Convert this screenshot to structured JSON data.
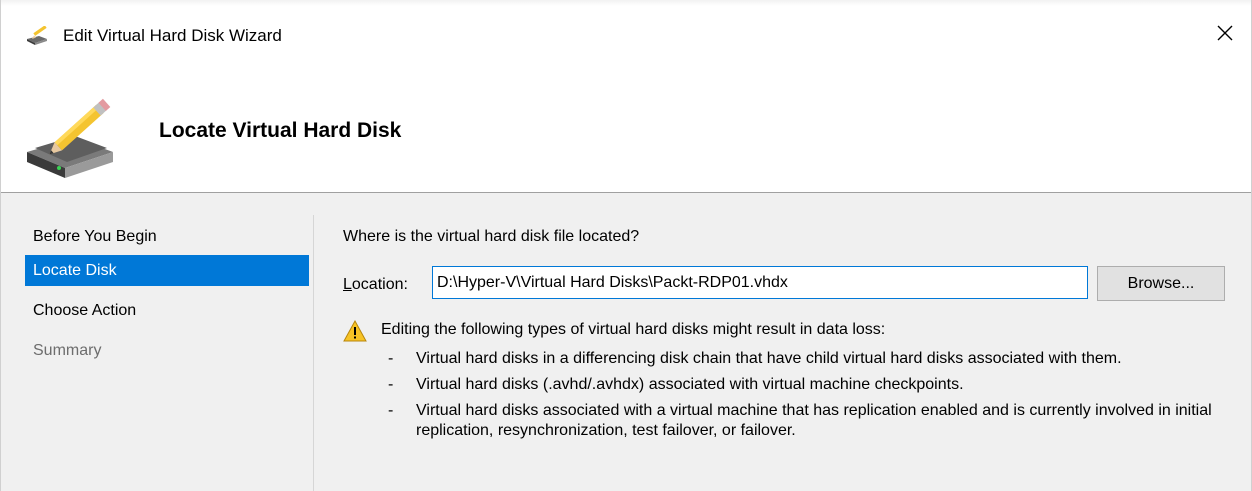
{
  "window": {
    "title": "Edit Virtual Hard Disk Wizard",
    "close_glyph": "✕"
  },
  "header": {
    "title": "Locate Virtual Hard Disk",
    "icon": "pencil-on-hard-disk-icon"
  },
  "nav": {
    "items": [
      {
        "label": "Before You Begin",
        "state": "normal"
      },
      {
        "label": "Locate Disk",
        "state": "selected"
      },
      {
        "label": "Choose Action",
        "state": "normal"
      },
      {
        "label": "Summary",
        "state": "disabled"
      }
    ]
  },
  "content": {
    "question": "Where is the virtual hard disk file located?",
    "location_label_accel": "L",
    "location_label_rest": "ocation:",
    "location_value": "D:\\Hyper-V\\Virtual Hard Disks\\Packt-RDP01.vhdx",
    "browse_label": "Browse...",
    "warning_icon": "warning-triangle-icon",
    "warning_text": "Editing the following types of virtual hard disks might result in data loss:",
    "bullet_glyph": "-",
    "bullets": [
      "Virtual hard disks in a differencing disk chain that have child virtual hard disks associated with them.",
      "Virtual hard disks (.avhd/.avhdx) associated with virtual machine checkpoints.",
      "Virtual hard disks associated with a virtual machine that has replication enabled and is currently involved in initial replication, resynchronization, test failover, or failover."
    ]
  },
  "colors": {
    "selection": "#0078d7",
    "panel_bg": "#f0f0f0",
    "disabled_text": "#6d6d6d",
    "warning_yellow": "#f7c325"
  }
}
